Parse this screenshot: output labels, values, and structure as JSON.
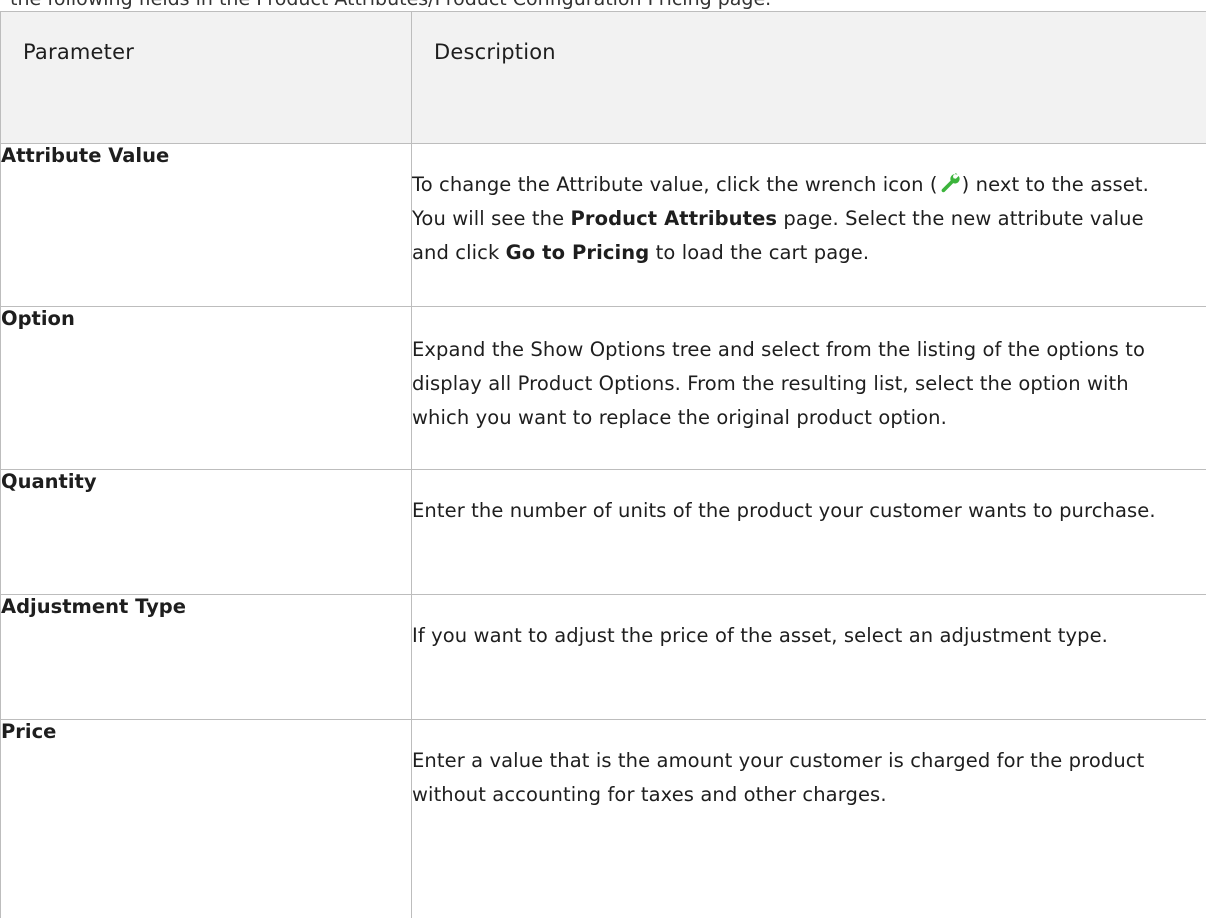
{
  "intro": "the following fields in the Product Attributes/Product Configuration Pricing page.",
  "table": {
    "header": {
      "param": "Parameter",
      "desc": "Description"
    },
    "rows": [
      {
        "name": "Attribute Value",
        "desc": {
          "p1": "To change the Attribute value, click the wrench icon (",
          "p2": ") next to the asset. You will see the ",
          "b1": "Product Attributes",
          "p3": " page. Select the new attribute value and click ",
          "b2": "Go to Pricing",
          "p4": " to load the cart page."
        },
        "icon": "wrench-icon"
      },
      {
        "name": "Option",
        "desc": "Expand the Show Options tree and select from the listing of the options to display all Product Options. From the resulting list, select the option with which you want to replace the original product option."
      },
      {
        "name": "Quantity",
        "desc": "Enter the number of units of the product your customer wants to purchase."
      },
      {
        "name": "Adjustment Type",
        "desc": "If you want to adjust the price of the asset, select an adjustment type."
      },
      {
        "name": "Price",
        "desc": "Enter a value that is the amount your customer is charged for the product without accounting for taxes and other charges."
      }
    ]
  },
  "colors": {
    "header_bg": "#f2f2f2",
    "border": "#bdbdbd",
    "wrench_icon": "#3cb43c"
  }
}
